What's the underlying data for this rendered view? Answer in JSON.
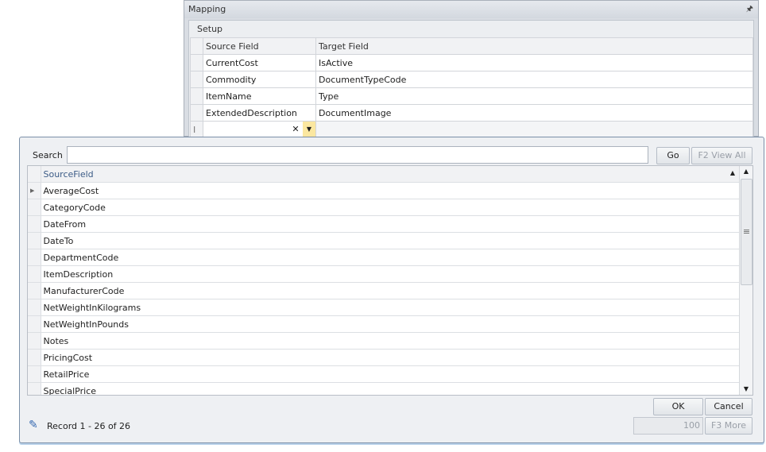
{
  "mapping": {
    "title": "Mapping",
    "pin_icon": "pin-icon",
    "group": "Setup",
    "columns": [
      "Source Field",
      "Target Field"
    ],
    "rows": [
      {
        "source": "CurrentCost",
        "target": "IsActive"
      },
      {
        "source": "Commodity",
        "target": "DocumentTypeCode"
      },
      {
        "source": "ItemName",
        "target": "Type"
      },
      {
        "source": "ExtendedDescription",
        "target": "DocumentImage"
      }
    ]
  },
  "popup": {
    "search_label": "Search",
    "search_value": "",
    "go": "Go",
    "view_all": "F2 View All",
    "column": "SourceField",
    "items": [
      "AverageCost",
      "CategoryCode",
      "DateFrom",
      "DateTo",
      "DepartmentCode",
      "ItemDescription",
      "ManufacturerCode",
      "NetWeightInKilograms",
      "NetWeightInPounds",
      "Notes",
      "PricingCost",
      "RetailPrice",
      "SpecialPrice"
    ],
    "ok": "OK",
    "cancel": "Cancel",
    "record_text": "Record 1 - 26 of 26",
    "page_size": "100",
    "more": "F3 More"
  }
}
